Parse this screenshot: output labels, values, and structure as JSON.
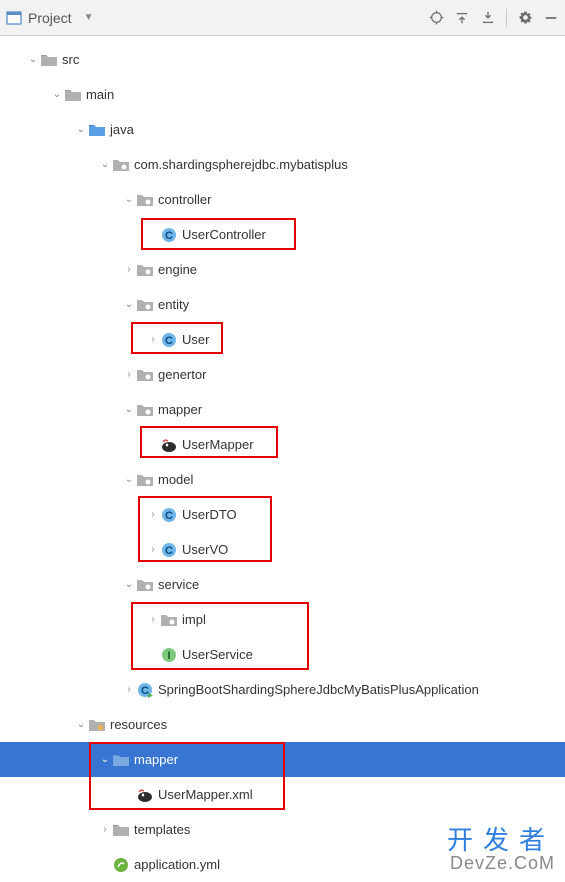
{
  "toolbar": {
    "title": "Project"
  },
  "tree": {
    "src": "src",
    "main": "main",
    "java": "java",
    "package": "com.shardingspherejdbc.mybatisplus",
    "controller": "controller",
    "userController": "UserController",
    "engine": "engine",
    "entity": "entity",
    "user": "User",
    "genertor": "genertor",
    "mapper": "mapper",
    "userMapper": "UserMapper",
    "model": "model",
    "userDTO": "UserDTO",
    "userVO": "UserVO",
    "service": "service",
    "impl": "impl",
    "userService": "UserService",
    "springBootApp": "SpringBootShardingSphereJdbcMyBatisPlusApplication",
    "resources": "resources",
    "mapperRes": "mapper",
    "userMapperXml": "UserMapper.xml",
    "templates": "templates",
    "appYml": "application.yml"
  },
  "watermark": {
    "line1": "开发者",
    "line2": "DevZe.CoM"
  }
}
